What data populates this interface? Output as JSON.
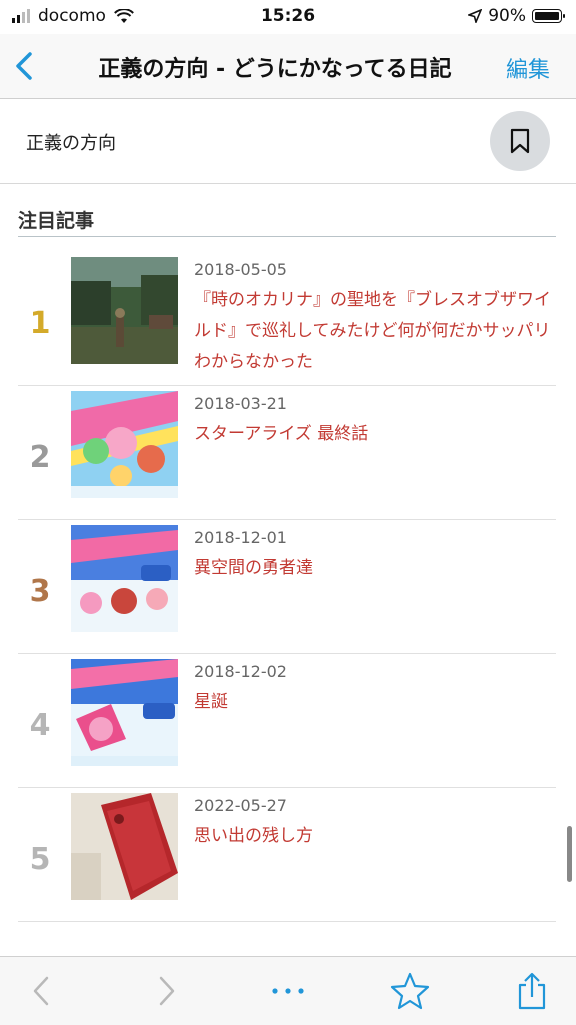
{
  "status": {
    "carrier": "docomo",
    "time": "15:26",
    "battery": "90%"
  },
  "nav": {
    "title": "正義の方向 - どうにかなってる日記",
    "edit_label": "編集"
  },
  "blog": {
    "name": "正義の方向"
  },
  "section": {
    "title": "注目記事"
  },
  "articles": [
    {
      "rank": "1",
      "date": "2018-05-05",
      "title": "『時のオカリナ』の聖地を『ブレスオブザワイルド』で巡礼してみたけど何が何だかサッパリわからなかった",
      "rank_color": "#d4aa2a"
    },
    {
      "rank": "2",
      "date": "2018-03-21",
      "title": "スターアライズ 最終話",
      "rank_color": "#9a9a9a"
    },
    {
      "rank": "3",
      "date": "2018-12-01",
      "title": "異空間の勇者達",
      "rank_color": "#b0764a"
    },
    {
      "rank": "4",
      "date": "2018-12-02",
      "title": "星誕",
      "rank_color": "#b5b5b5"
    },
    {
      "rank": "5",
      "date": "2022-05-27",
      "title": "思い出の残し方",
      "rank_color": "#b5b5b5"
    }
  ],
  "colors": {
    "accent": "#2196d8",
    "link": "#c23a33"
  }
}
